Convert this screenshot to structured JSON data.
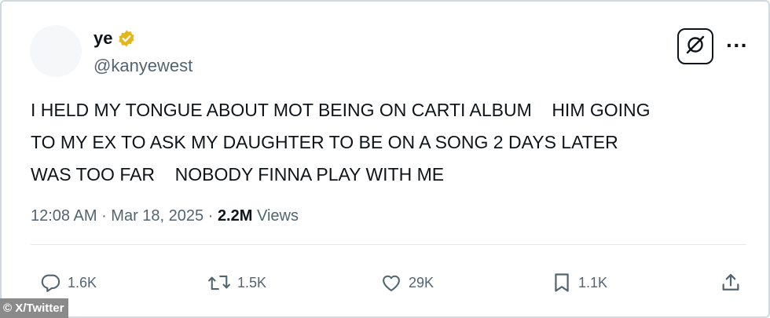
{
  "author": {
    "display_name": "ye",
    "handle": "@kanyewest",
    "verified_icon": "verified-badge-gold"
  },
  "tweet": {
    "text_lines": [
      "I HELD MY TONGUE ABOUT MOT BEING ON CARTI ALBUM    HIM GOING",
      "TO MY EX TO ASK MY DAUGHTER TO BE ON A SONG 2 DAYS LATER",
      "WAS TOO FAR    NOBODY FINNA PLAY WITH ME"
    ]
  },
  "meta": {
    "time": "12:08 AM",
    "sep1": " · ",
    "date": "Mar 18, 2025",
    "sep2": " · ",
    "views_count": "2.2M",
    "views_label": " Views"
  },
  "header_actions": {
    "grok_icon": "grok-icon",
    "more_label": "···"
  },
  "actions": {
    "replies": "1.6K",
    "reposts": "1.5K",
    "likes": "29K",
    "bookmarks": "1.1K"
  },
  "credit": "© X/Twitter",
  "colors": {
    "text_primary": "#0f1419",
    "text_secondary": "#536471",
    "verified_gold": "#e2b719",
    "border": "#cfd9de",
    "credit_bg": "#8a8a8a"
  }
}
